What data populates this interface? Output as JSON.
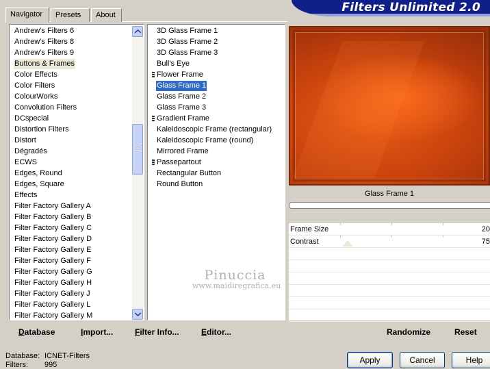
{
  "banner": {
    "title": "Filters Unlimited 2.0"
  },
  "tabs": [
    {
      "label": "Navigator",
      "active": true
    },
    {
      "label": "Presets",
      "active": false
    },
    {
      "label": "About",
      "active": false
    }
  ],
  "categories": {
    "selected": "Buttons & Frames",
    "items": [
      "Andrew's Filters 6",
      "Andrew's Filters 8",
      "Andrew's Filters 9",
      "Buttons & Frames",
      "Color Effects",
      "Color Filters",
      "ColourWorks",
      "Convolution Filters",
      "DCspecial",
      "Distortion Filters",
      "Distort",
      "Dégradés",
      "ECWS",
      "Edges, Round",
      "Edges, Square",
      "Effects",
      "Filter Factory Gallery A",
      "Filter Factory Gallery B",
      "Filter Factory Gallery C",
      "Filter Factory Gallery D",
      "Filter Factory Gallery E",
      "Filter Factory Gallery F",
      "Filter Factory Gallery G",
      "Filter Factory Gallery H",
      "Filter Factory Gallery J",
      "Filter Factory Gallery L",
      "Filter Factory Gallery M"
    ]
  },
  "filters": {
    "selected": "Glass Frame 1",
    "items": [
      {
        "label": "3D Glass Frame 1",
        "submenu": false
      },
      {
        "label": "3D Glass Frame 2",
        "submenu": false
      },
      {
        "label": "3D Glass Frame 3",
        "submenu": false
      },
      {
        "label": "Bull's Eye",
        "submenu": false
      },
      {
        "label": "Flower Frame",
        "submenu": true
      },
      {
        "label": "Glass Frame 1",
        "submenu": false
      },
      {
        "label": "Glass Frame 2",
        "submenu": false
      },
      {
        "label": "Glass Frame 3",
        "submenu": false
      },
      {
        "label": "Gradient Frame",
        "submenu": true
      },
      {
        "label": "Kaleidoscopic Frame (rectangular)",
        "submenu": false
      },
      {
        "label": "Kaleidoscopic Frame (round)",
        "submenu": false
      },
      {
        "label": "Mirrored Frame",
        "submenu": false
      },
      {
        "label": "Passepartout",
        "submenu": true
      },
      {
        "label": "Rectangular Button",
        "submenu": false
      },
      {
        "label": "Round Button",
        "submenu": false
      }
    ]
  },
  "watermark": {
    "line1": "Pinuccia",
    "line2": "www.maidiregrafica.eu"
  },
  "preview": {
    "label": "Glass Frame 1"
  },
  "params": [
    {
      "name": "Frame Size",
      "value": "20"
    },
    {
      "name": "Contrast",
      "value": "75"
    }
  ],
  "toolbar_left": [
    {
      "id": "database",
      "label": "Database",
      "underline": "D"
    },
    {
      "id": "import",
      "label": "Import...",
      "underline": "I"
    },
    {
      "id": "filter-info",
      "label": "Filter Info...",
      "underline": "F"
    },
    {
      "id": "editor",
      "label": "Editor...",
      "underline": "E"
    }
  ],
  "toolbar_right": [
    {
      "id": "randomize",
      "label": "Randomize"
    },
    {
      "id": "reset",
      "label": "Reset"
    }
  ],
  "status": {
    "database_label": "Database:",
    "database_value": "ICNET-Filters",
    "filters_label": "Filters:",
    "filters_value": "995"
  },
  "buttons": {
    "apply": "Apply",
    "cancel": "Cancel",
    "help": "Help"
  }
}
